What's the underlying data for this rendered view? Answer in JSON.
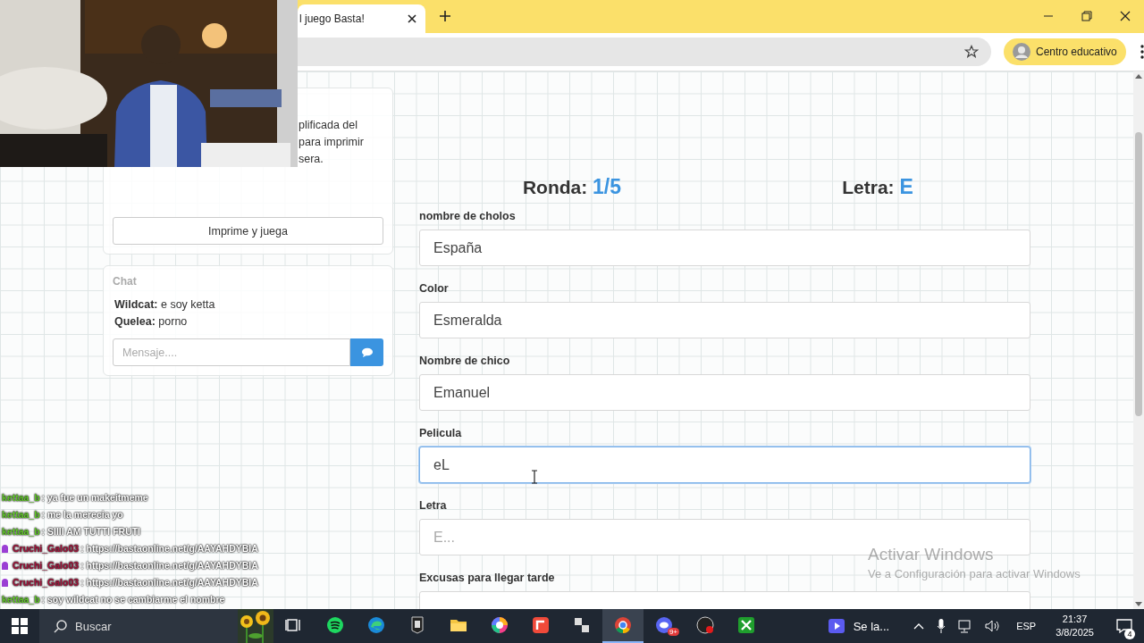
{
  "browser": {
    "tab": {
      "title": "l juego Basta!"
    },
    "profile": "Centro educativo"
  },
  "sidebar": {
    "info_lines": [
      "plificada del",
      "para imprimir",
      "sera."
    ],
    "print_button": "Imprime y juega",
    "chat": {
      "title": "Chat",
      "messages": [
        {
          "user": "Wildcat:",
          "text": "e soy ketta"
        },
        {
          "user": "Quelea:",
          "text": "porno"
        }
      ],
      "placeholder": "Mensaje...."
    }
  },
  "game": {
    "round_label": "Ronda:",
    "round": "1/5",
    "letter_label": "Letra:",
    "letter": "E",
    "fields": [
      {
        "label": "nombre de cholos",
        "value": "España",
        "focused": false
      },
      {
        "label": "Color",
        "value": "Esmeralda",
        "focused": false
      },
      {
        "label": "Nombre de chico",
        "value": "Emanuel",
        "focused": false
      },
      {
        "label": "Pelicula",
        "value": "eL",
        "focused": true
      },
      {
        "label": "Letra",
        "placeholder": "E...",
        "focused": false
      },
      {
        "label": "Excusas para llegar tarde",
        "focused": false
      }
    ]
  },
  "watermark": {
    "title": "Activar Windows",
    "text": "Ve a Configuración para activar Windows"
  },
  "stream_chat": [
    {
      "user": "kettaa_b",
      "color": "#62c92a",
      "badge": false,
      "text": ": ya fue un makeitmeme"
    },
    {
      "user": "kettaa_b",
      "color": "#62c92a",
      "badge": false,
      "text": ": me la merecia yo"
    },
    {
      "user": "kettaa_b",
      "color": "#62c92a",
      "badge": false,
      "text": ": SIIII AM TUTTI FRUTI"
    },
    {
      "user": "Cruchi_Galo03",
      "color": "#a3123a",
      "badge": true,
      "text": ": https://bastaonline.net/g/AAYAHDYBIA"
    },
    {
      "user": "Cruchi_Galo03",
      "color": "#a3123a",
      "badge": true,
      "text": ": https://bastaonline.net/g/AAYAHDYBIA"
    },
    {
      "user": "Cruchi_Galo03",
      "color": "#a3123a",
      "badge": true,
      "text": ": https://bastaonline.net/g/AAYAHDYBIA"
    },
    {
      "user": "kettaa_b",
      "color": "#62c92a",
      "badge": false,
      "text": ": soy wildcat no se cambiarme el nombre"
    }
  ],
  "taskbar": {
    "search": "Buscar",
    "apps": [
      {
        "kind": "taskview",
        "selected": false
      },
      {
        "kind": "spotify",
        "selected": false
      },
      {
        "kind": "edge",
        "selected": false
      },
      {
        "kind": "epic",
        "selected": false
      },
      {
        "kind": "folder",
        "selected": false
      },
      {
        "kind": "wheel",
        "selected": false
      },
      {
        "kind": "redapp",
        "selected": false
      },
      {
        "kind": "bm",
        "selected": false
      },
      {
        "kind": "chrome",
        "selected": true
      },
      {
        "kind": "discord",
        "selected": false,
        "badge": "9+"
      },
      {
        "kind": "obs",
        "selected": false
      },
      {
        "kind": "xbox",
        "selected": false
      }
    ],
    "media": "Se la...",
    "language": "ESP",
    "time": "21:37",
    "date": "3/8/2025",
    "notifications": "4"
  }
}
